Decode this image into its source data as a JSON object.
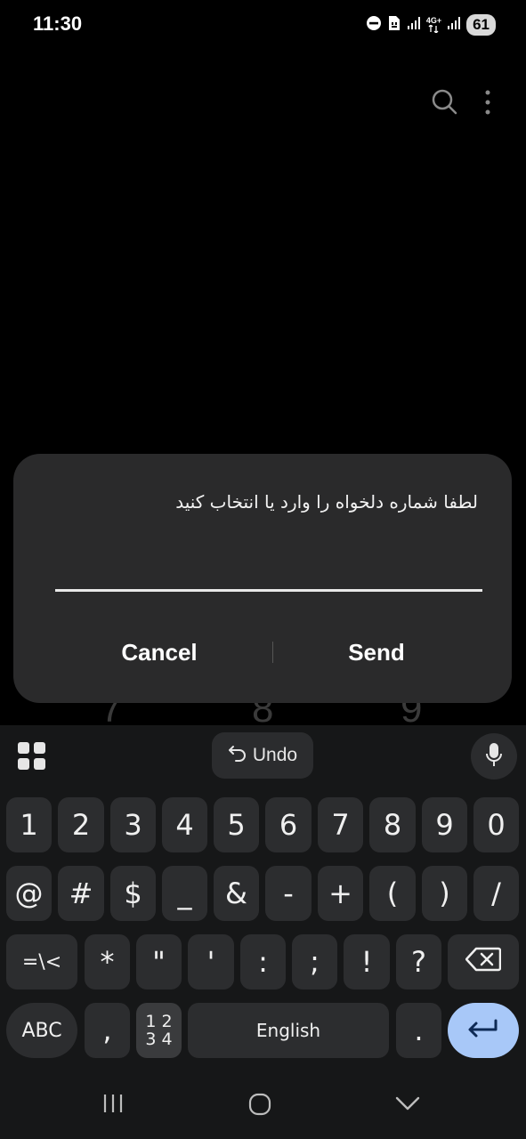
{
  "status_bar": {
    "time": "11:30",
    "network_label": "4G+",
    "battery": "61",
    "icons": [
      "dnd-icon",
      "sim-icon",
      "signal-icon",
      "signal-4g-icon",
      "signal-icon",
      "battery-icon"
    ]
  },
  "top_actions": {
    "icons": [
      "search-icon",
      "more-vert-icon"
    ]
  },
  "background_digits": [
    "7",
    "8",
    "9"
  ],
  "dialog": {
    "message": "لطفا شماره دلخواه را وارد یا انتخاب کنید",
    "input_value": "",
    "cancel_label": "Cancel",
    "send_label": "Send"
  },
  "keyboard": {
    "toolbar": {
      "undo_label": "Undo",
      "icons": [
        "apps-grid-icon",
        "undo-icon",
        "mic-icon"
      ]
    },
    "row1": [
      "1",
      "2",
      "3",
      "4",
      "5",
      "6",
      "7",
      "8",
      "9",
      "0"
    ],
    "row2": [
      "@",
      "#",
      "$",
      "_",
      "&",
      "-",
      "+",
      "(",
      ")",
      "/"
    ],
    "row3": [
      "=\\<",
      "*",
      "\"",
      "'",
      ":",
      ";",
      "!",
      "?"
    ],
    "row4": {
      "abc_label": "ABC",
      "comma": ",",
      "numpad_top": "1 2",
      "numpad_bottom": "3 4",
      "space_label": "English",
      "period": "."
    },
    "accent_color": "#a8c8f8"
  },
  "navigation_bar": {
    "icons": [
      "recents-icon",
      "home-icon",
      "back-chevron-icon"
    ]
  }
}
